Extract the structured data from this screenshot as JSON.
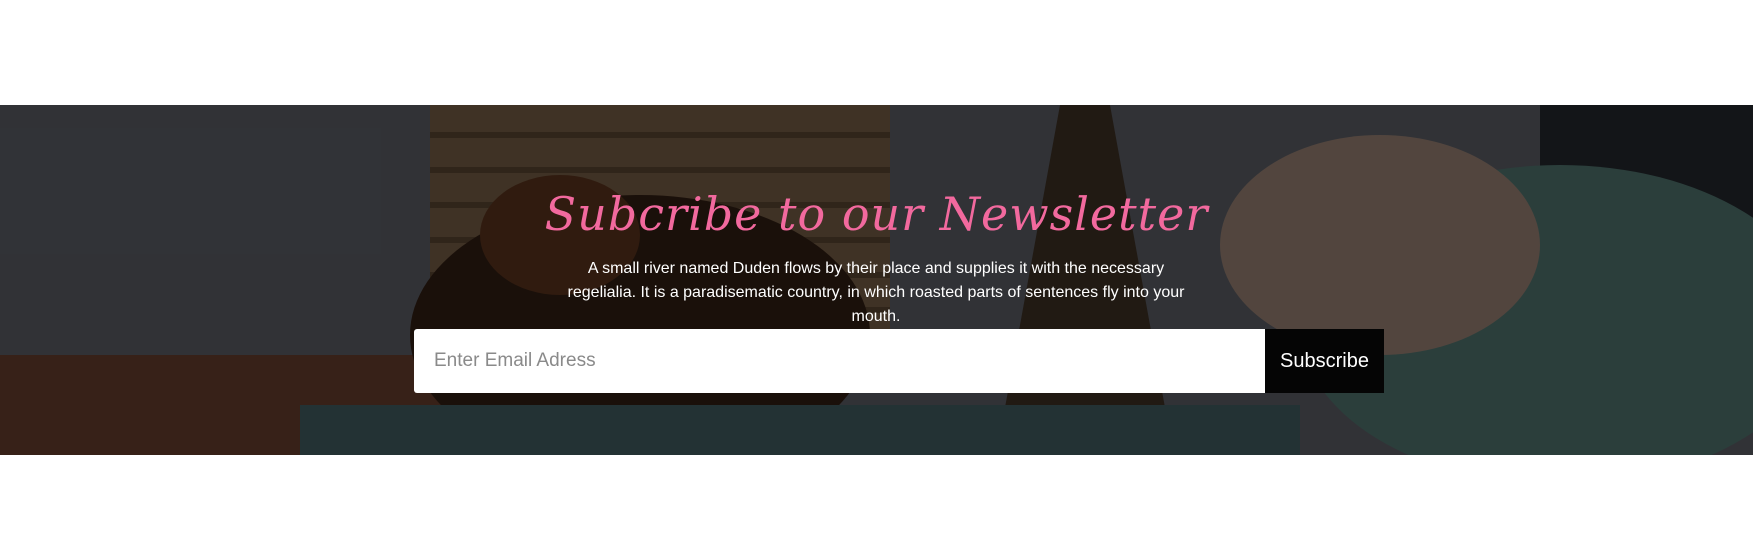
{
  "newsletter": {
    "title": "Subcribe to our Newsletter",
    "description": "A small river named Duden flows by their place and supplies it with the necessary regelialia. It is a paradisematic country, in which roasted parts of sentences fly into your mouth.",
    "email_placeholder": "Enter Email Adress",
    "subscribe_label": "Subscribe"
  },
  "colors": {
    "title": "#f2699e",
    "button": "#050505",
    "overlay": "rgba(0,0,0,0.55)"
  }
}
